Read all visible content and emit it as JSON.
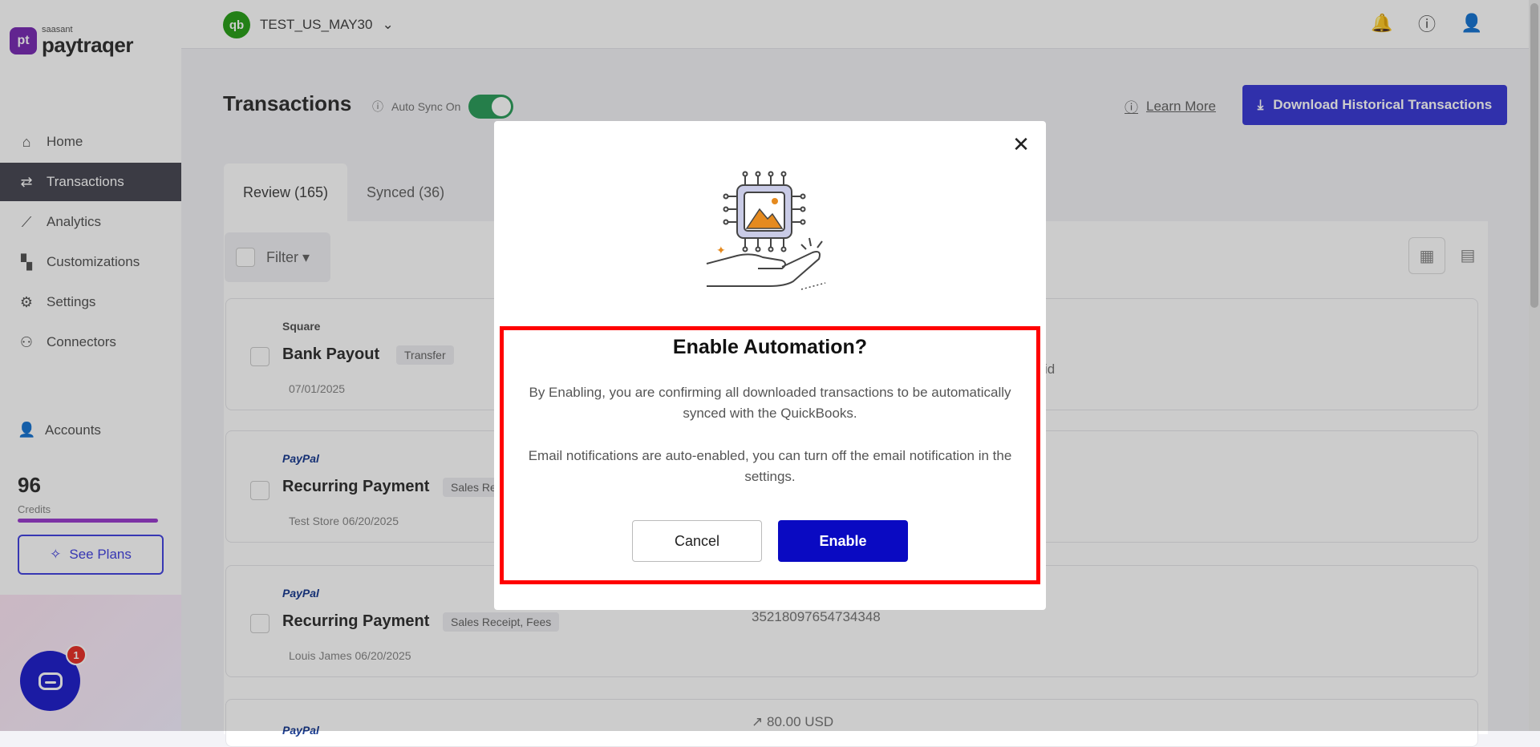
{
  "app": {
    "logo_mark": "pt",
    "logo_small": "saasant",
    "logo_big": "paytraqer"
  },
  "topbar": {
    "org_logo": "qb",
    "org_name": "TEST_US_MAY30",
    "icons": [
      "bell-icon",
      "help-icon",
      "user-settings-icon"
    ]
  },
  "sidebar": {
    "items": [
      {
        "label": "Home",
        "icon": "⌂",
        "active": false
      },
      {
        "label": "Transactions",
        "icon": "⇄",
        "active": true
      },
      {
        "label": "Analytics",
        "icon": "⟋",
        "active": false
      },
      {
        "label": "Customizations",
        "icon": "▚",
        "active": false
      },
      {
        "label": "Settings",
        "icon": "⚙",
        "active": false
      },
      {
        "label": "Connectors",
        "icon": "⚇",
        "active": false
      }
    ],
    "accounts_label": "Accounts",
    "credits_value": "96",
    "credits_label": "Credits",
    "credits_fraction": 1.0,
    "see_plans_label": "See Plans",
    "chat_badge": "1"
  },
  "main": {
    "page_title": "Transactions",
    "autosync_label": "Auto Sync On",
    "learn_more_label": "Learn More",
    "download_label": "Download Historical Transactions",
    "tabs": [
      {
        "label": "Review (165)"
      },
      {
        "label": "Synced (36)"
      }
    ],
    "filter_label": "Filter",
    "cards": [
      {
        "source": "Square",
        "title": "Bank Payout",
        "tag": "Transfer",
        "sub": "07/01/2025",
        "right": "id"
      },
      {
        "source": "PayPal",
        "title": "Recurring Payment",
        "tag": "Sales Re",
        "sub": "Test Store  06/20/2025",
        "right": ""
      },
      {
        "source": "PayPal",
        "title": "Recurring Payment",
        "tag": "Sales Receipt, Fees",
        "sub": "Louis James  06/20/2025",
        "right": "35218097654734348"
      },
      {
        "source": "PayPal",
        "title": "",
        "tag": "",
        "sub": "",
        "right": "80.00 USD"
      }
    ]
  },
  "modal": {
    "title": "Enable Automation?",
    "paragraph_1": "By Enabling, you are confirming all downloaded transactions to be automatically synced with the QuickBooks.",
    "paragraph_2": "Email notifications are auto-enabled, you can turn off the email notification in the settings.",
    "cancel_label": "Cancel",
    "enable_label": "Enable",
    "close_glyph": "✕"
  },
  "colors": {
    "accent": "#3d3dd6",
    "enable_button": "#0a0ac2",
    "highlight": "#ff0000",
    "toggle_on": "#2f9e5d",
    "sidebar_active": "#4a4a55"
  }
}
